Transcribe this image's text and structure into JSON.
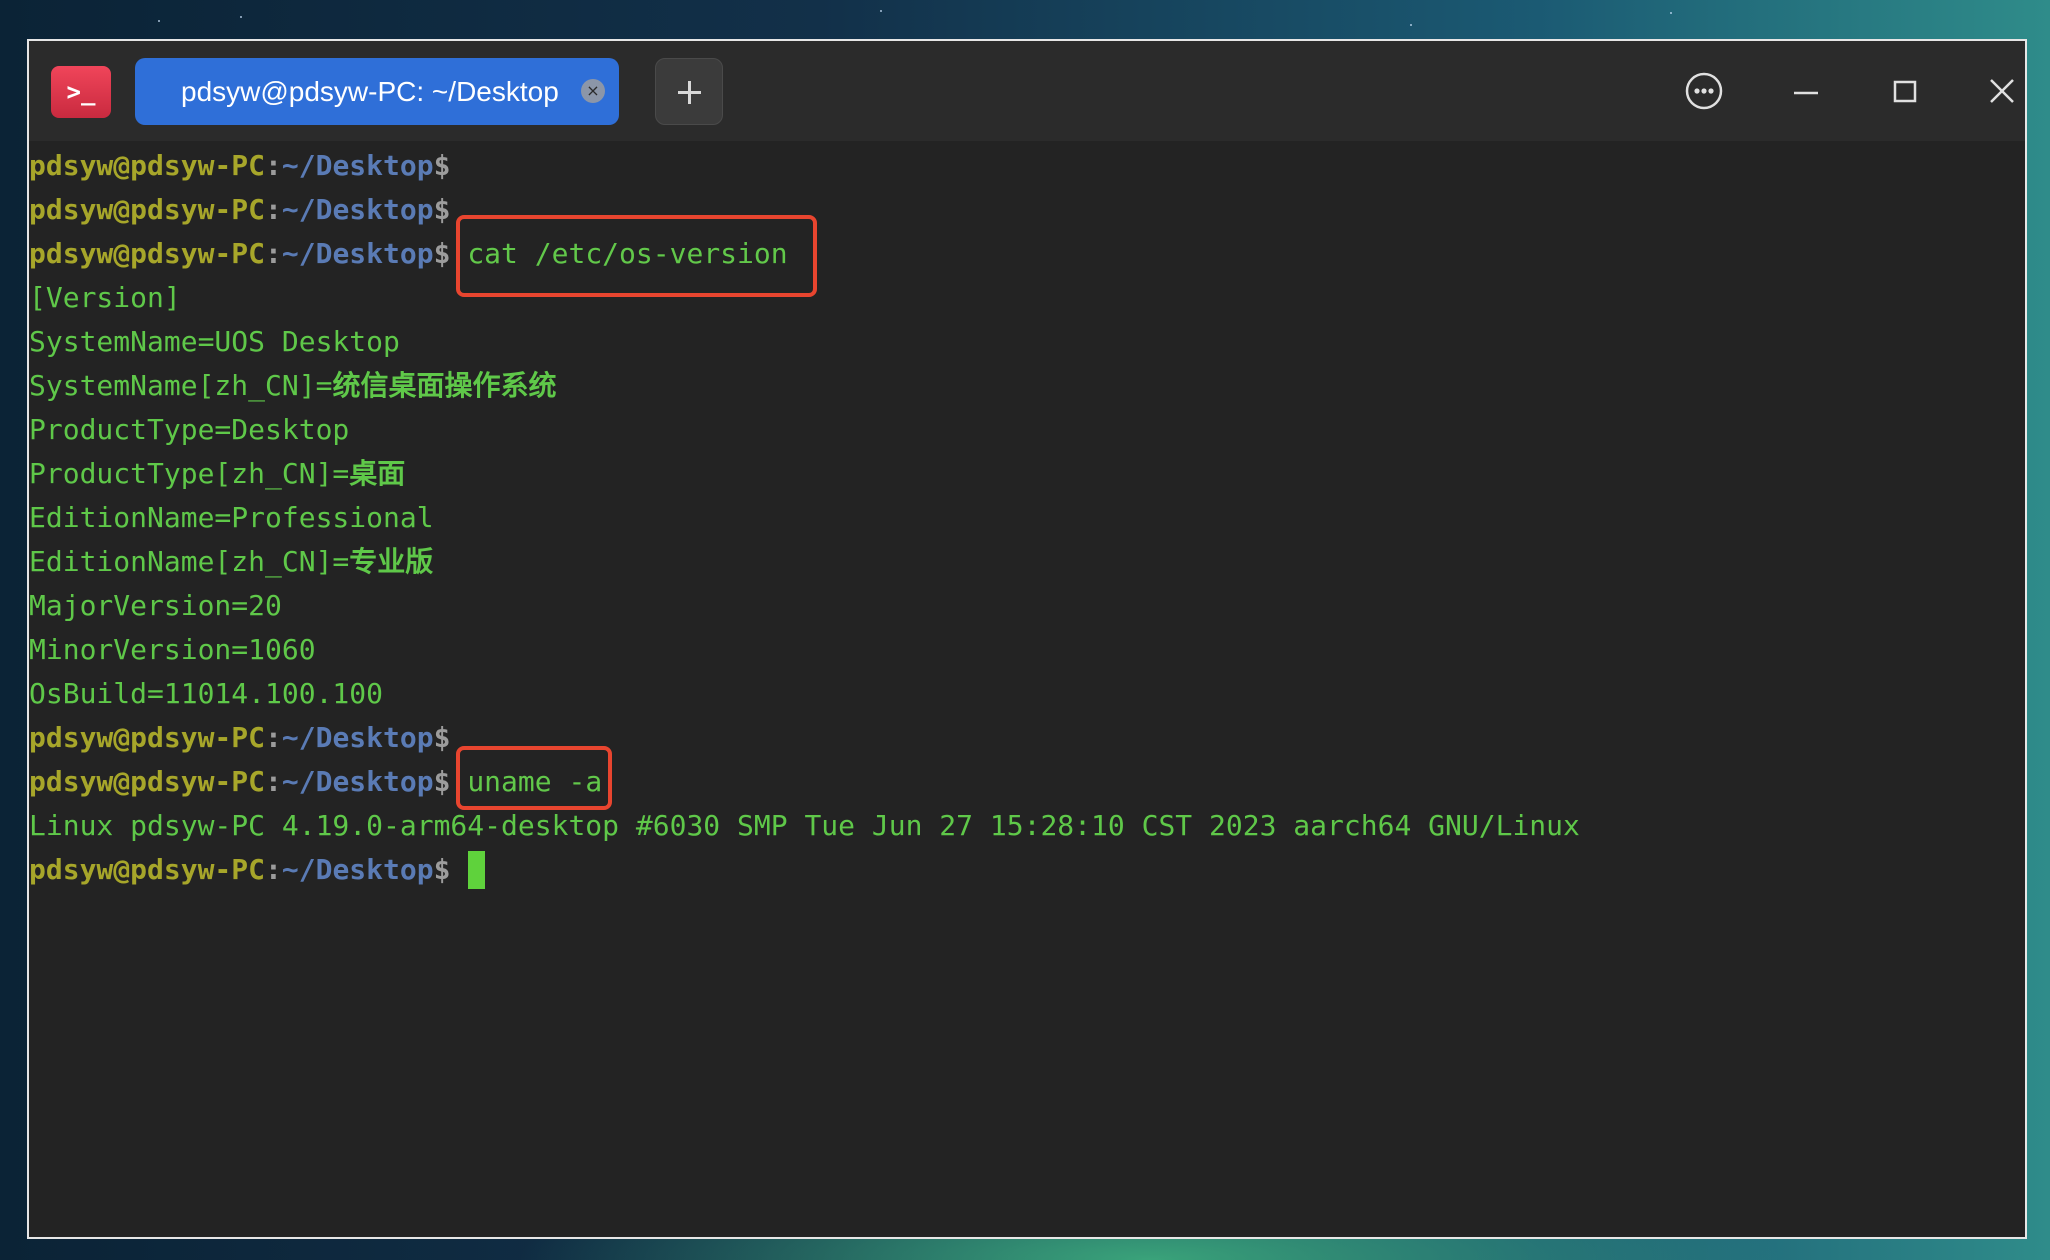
{
  "window": {
    "title_tab": "pdsyw@pdsyw-PC: ~/Desktop"
  },
  "icons": {
    "app": "terminal-app-icon",
    "tab_close": "close-icon",
    "new_tab": "plus-icon",
    "menu": "more-options-icon",
    "minimize": "minimize-icon",
    "maximize": "maximize-icon",
    "close": "close-window-icon"
  },
  "prompt": {
    "user_host": "pdsyw@pdsyw-PC",
    "colon": ":",
    "path": "~/Desktop",
    "dollar": "$"
  },
  "lines": [
    {
      "type": "prompt",
      "command": ""
    },
    {
      "type": "prompt",
      "command": ""
    },
    {
      "type": "prompt",
      "command": "cat /etc/os-version"
    },
    {
      "type": "output",
      "text": "[Version]"
    },
    {
      "type": "output",
      "text": "SystemName=UOS Desktop"
    },
    {
      "type": "output",
      "text": "SystemName[zh_CN]=",
      "cjk": "统信桌面操作系统"
    },
    {
      "type": "output",
      "text": "ProductType=Desktop"
    },
    {
      "type": "output",
      "text": "ProductType[zh_CN]=",
      "cjk": "桌面"
    },
    {
      "type": "output",
      "text": "EditionName=Professional"
    },
    {
      "type": "output",
      "text": "EditionName[zh_CN]=",
      "cjk": "专业版"
    },
    {
      "type": "output",
      "text": "MajorVersion=20"
    },
    {
      "type": "output",
      "text": "MinorVersion=1060"
    },
    {
      "type": "output",
      "text": "OsBuild=11014.100.100"
    },
    {
      "type": "prompt",
      "command": ""
    },
    {
      "type": "prompt",
      "command": "uname -a"
    },
    {
      "type": "output",
      "text": "Linux pdsyw-PC 4.19.0-arm64-desktop #6030 SMP Tue Jun 27 15:28:10 CST 2023 aarch64 GNU/Linux"
    },
    {
      "type": "prompt",
      "command": ""
    }
  ],
  "colors": {
    "prompt_user": "#a7a62a",
    "prompt_path": "#5a7bb5",
    "output_text": "#5fc849",
    "highlight_box": "#e8452f",
    "tab_active": "#2f6fd8",
    "terminal_bg": "#232323"
  }
}
